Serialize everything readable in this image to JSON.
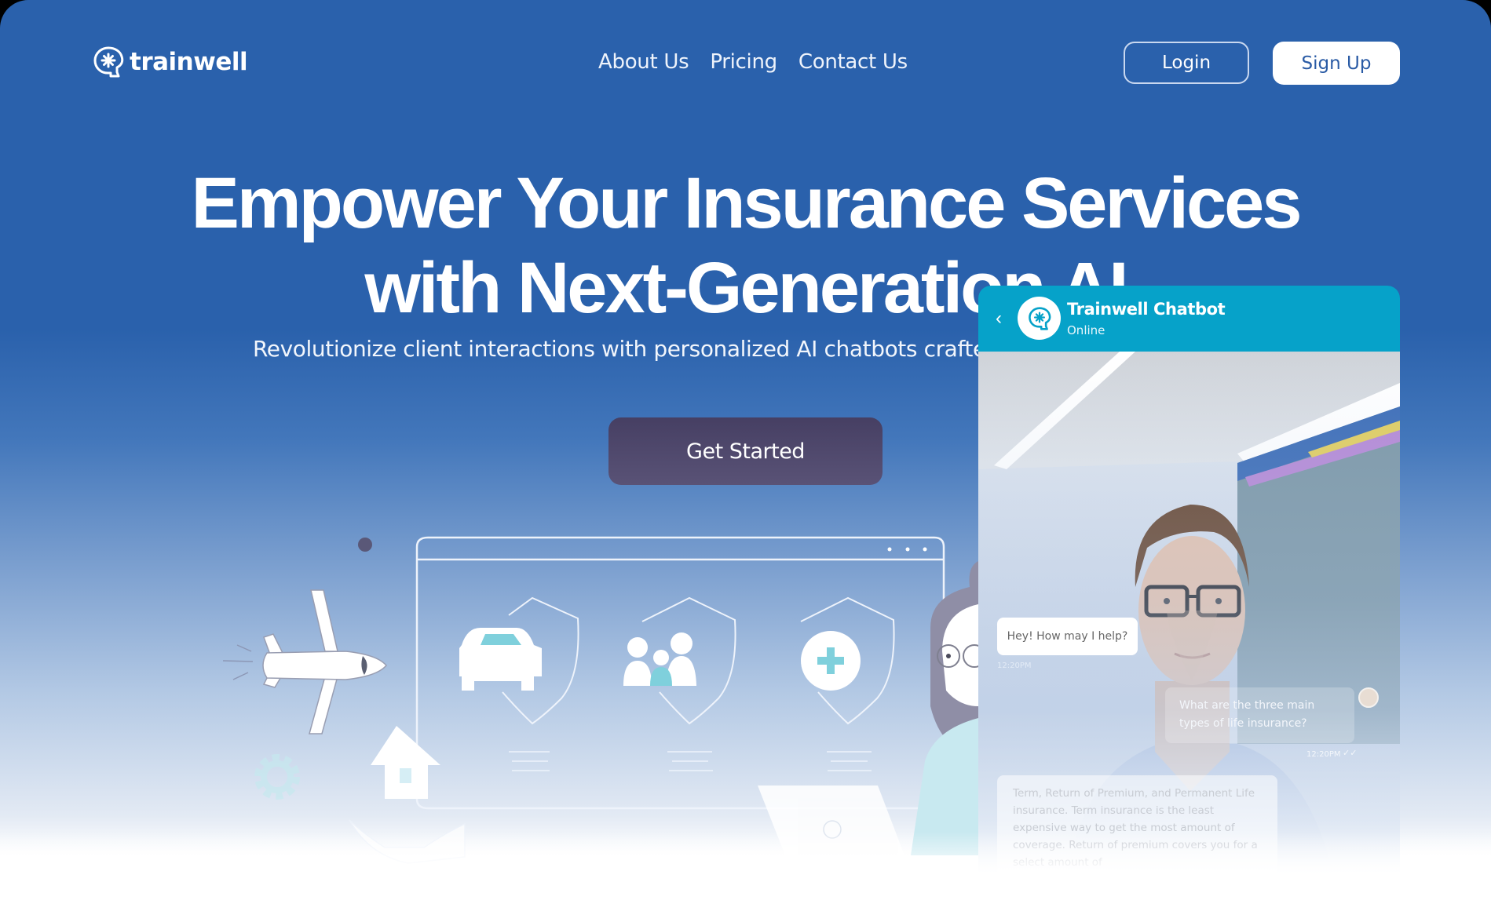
{
  "brand": {
    "name": "trainwell",
    "logo_icon": "head-asterisk-icon"
  },
  "nav": {
    "links": [
      "About Us",
      "Pricing",
      "Contact Us"
    ],
    "login_label": "Login",
    "signup_label": "Sign Up"
  },
  "hero": {
    "title_line1": "Empower Your Insurance Services",
    "title_line2": "with Next-Generation AI",
    "subtitle": "Revolutionize client interactions with personalized AI chatbots crafted",
    "cta_label": "Get Started"
  },
  "illustration": {
    "icons": [
      "airplane-icon",
      "house-icon",
      "gear-icon",
      "hand-icon",
      "car-shield-icon",
      "family-shield-icon",
      "health-shield-icon",
      "person-with-laptop"
    ]
  },
  "chat": {
    "back_icon": "chevron-left-icon",
    "name": "Trainwell Chatbot",
    "status": "Online",
    "messages": [
      {
        "from": "bot",
        "text": "Hey! How may I help?",
        "time": "12:20PM"
      },
      {
        "from": "user",
        "text": "What are the three main types of life insurance?",
        "time": "12:20PM",
        "read_icon": "double-check-icon"
      },
      {
        "from": "bot",
        "text": "Term, Return of Premium, and Permanent Life insurance. Term insurance is the least expensive way to get the most amount of coverage. Return of premium covers you for a select amount of"
      }
    ]
  },
  "colors": {
    "primary_blue": "#2a61ac",
    "chat_header": "#06a2c9",
    "cta_purple": "#4a4368",
    "signup_text": "#2a5ba5",
    "accent_teal": "#7fd0dc"
  }
}
